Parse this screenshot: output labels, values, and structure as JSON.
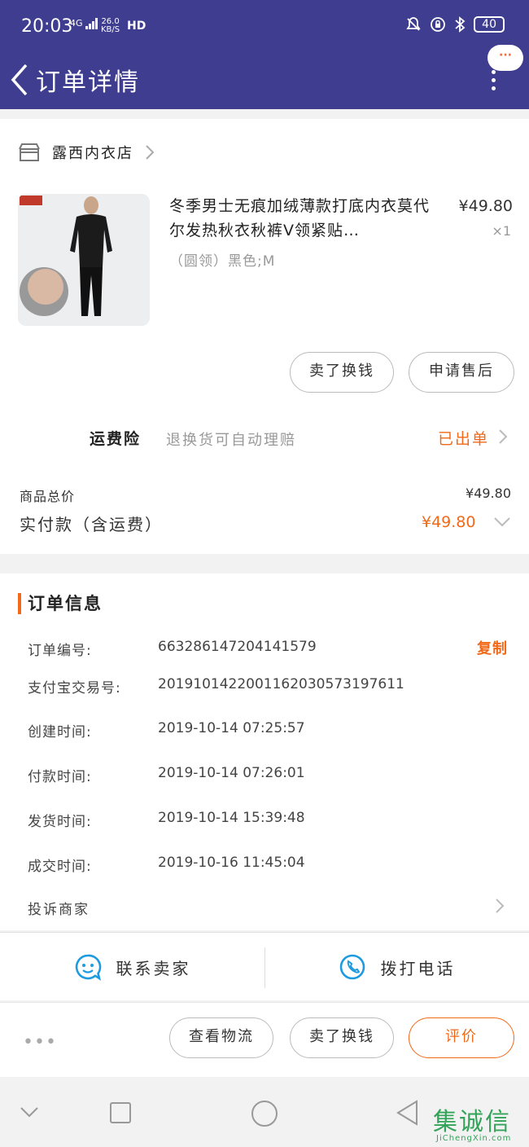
{
  "status_bar": {
    "time": "20:03",
    "network": "4G",
    "speed_value": "26.0",
    "speed_unit": "KB/S",
    "hd": "HD",
    "battery": "40"
  },
  "nav": {
    "title": "订单详情",
    "bubble": "···"
  },
  "store": {
    "name": "露西内衣店"
  },
  "product": {
    "title": "冬季男士无痕加绒薄款打底内衣莫代尔发热秋衣秋裤V领紧贴…",
    "spec": "（圆领）黑色;M",
    "price": "¥49.80",
    "qty": "×1"
  },
  "item_buttons": {
    "sell": "卖了换钱",
    "after_sale": "申请售后"
  },
  "insurance": {
    "label": "运费险",
    "desc": "退换货可自动理赔",
    "status": "已出单"
  },
  "totals": {
    "goods_label": "商品总价",
    "goods_value": "¥49.80",
    "paid_label": "实付款（含运费）",
    "paid_value": "¥49.80"
  },
  "order_info": {
    "title": "订单信息",
    "copy_label": "复制",
    "rows": [
      {
        "label": "订单编号:",
        "value": "663286147204141579"
      },
      {
        "label": "支付宝交易号:",
        "value": "2019101422001162030573197611"
      },
      {
        "label": "创建时间:",
        "value": "2019-10-14 07:25:57"
      },
      {
        "label": "付款时间:",
        "value": "2019-10-14 07:26:01"
      },
      {
        "label": "发货时间:",
        "value": "2019-10-14 15:39:48"
      },
      {
        "label": "成交时间:",
        "value": "2019-10-16 11:45:04"
      }
    ],
    "complain": "投诉商家"
  },
  "contact": {
    "seller": "联系卖家",
    "call": "拨打电话"
  },
  "actions": {
    "more": "•••",
    "logistics": "查看物流",
    "sell": "卖了换钱",
    "review": "评价"
  },
  "watermark": {
    "text": "集诚信",
    "url": "JiChengXin.com"
  },
  "colors": {
    "nav_bg": "#3f3d8f",
    "accent": "#f06a1a",
    "contact_icon": "#1e9be0"
  }
}
